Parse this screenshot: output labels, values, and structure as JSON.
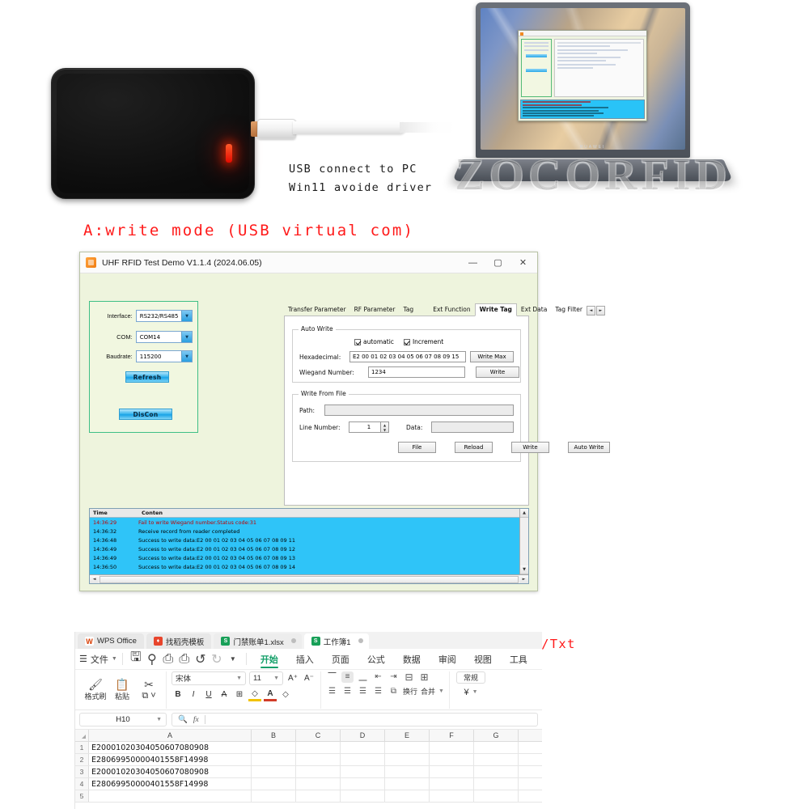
{
  "photo": {
    "device_name": "uhf-rfid-reader",
    "note_line1": "USB connect to PC",
    "note_line2": "Win11 avoide driver",
    "laptop_brand": "HUAWEI",
    "watermark": "ZOCORFID"
  },
  "captions": {
    "a": "A:write mode (USB virtual com)",
    "b": "B:USB HID keyboard Read data only.Ext Data to Excel/DO/Txt"
  },
  "rfid_app": {
    "title": "UHF RFID Test Demo V1.1.4  (2024.06.05)",
    "window_controls": {
      "minimize": "—",
      "maximize": "▢",
      "close": "✕"
    },
    "connection": {
      "interface_label": "Interface:",
      "interface_value": "RS232/RS485",
      "com_label": "COM:",
      "com_value": "COM14",
      "baudrate_label": "Baudrate:",
      "baudrate_value": "115200",
      "refresh_button": "Refresh",
      "discon_button": "DisCon"
    },
    "tabs": [
      {
        "label": "Transfer Parameter",
        "active": false
      },
      {
        "label": "RF Parameter",
        "active": false
      },
      {
        "label": "Tag",
        "active": false
      },
      {
        "label": "Ext Function",
        "active": false
      },
      {
        "label": "Write Tag",
        "active": true
      },
      {
        "label": "Ext Data",
        "active": false
      },
      {
        "label": "Tag Filter",
        "active": false
      }
    ],
    "tab_scroll": {
      "left": "◄",
      "right": "►"
    },
    "auto_write": {
      "group_title": "Auto Write",
      "chk_automatic": "automatic",
      "chk_increment": "Increment",
      "hex_label": "Hexadecimal:",
      "hex_value": "E2 00 01 02 03 04 05 06 07 08 09 15",
      "write_max_button": "Write Max",
      "wiegand_label": "Wiegand Number:",
      "wiegand_value": "1234",
      "write_button": "Write"
    },
    "write_from_file": {
      "group_title": "Write From File",
      "path_label": "Path:",
      "path_value": "",
      "line_number_label": "Line Number:",
      "line_number_value": "1",
      "data_label": "Data:",
      "data_value": "",
      "buttons": [
        "File",
        "Reload",
        "Write",
        "Auto Write"
      ]
    },
    "log": {
      "headers": [
        "Time",
        "Conten"
      ],
      "rows": [
        {
          "time": "14:36:29",
          "content": "Fail to write Wiegand number.Status code:31",
          "error": true
        },
        {
          "time": "14:36:32",
          "content": "Receive record from reader completed",
          "error": false
        },
        {
          "time": "14:36:48",
          "content": "Success to write data:E2 00 01 02 03 04 05 06 07 08 09 11",
          "error": false
        },
        {
          "time": "14:36:49",
          "content": "Success to write data:E2 00 01 02 03 04 05 06 07 08 09 12",
          "error": false
        },
        {
          "time": "14:36:49",
          "content": "Success to write data:E2 00 01 02 03 04 05 06 07 08 09 13",
          "error": false
        },
        {
          "time": "14:36:50",
          "content": "Success to write data:E2 00 01 02 03 04 05 06 07 08 09 14",
          "error": false
        }
      ]
    }
  },
  "wps": {
    "tabs": [
      {
        "label": "WPS Office",
        "icon": "wps-icon",
        "kind": "w",
        "active": false,
        "closable": false
      },
      {
        "label": "找稻壳模板",
        "icon": "template-icon",
        "kind": "d",
        "active": false,
        "closable": false
      },
      {
        "label": "门禁账单1.xlsx",
        "icon": "sheet-icon",
        "kind": "s",
        "active": false,
        "closable": true
      },
      {
        "label": "工作簿1",
        "icon": "sheet-icon",
        "kind": "s",
        "active": true,
        "closable": true
      }
    ],
    "ribbon": {
      "file_menu": "文件",
      "quick_icons": [
        "save-icon",
        "cloud-sync-icon",
        "print-icon",
        "print-preview-icon",
        "undo-icon",
        "redo-icon",
        "more-icon"
      ],
      "tabs": [
        {
          "label": "开始",
          "active": true
        },
        {
          "label": "插入",
          "active": false
        },
        {
          "label": "页面",
          "active": false
        },
        {
          "label": "公式",
          "active": false
        },
        {
          "label": "数据",
          "active": false
        },
        {
          "label": "审阅",
          "active": false
        },
        {
          "label": "视图",
          "active": false
        },
        {
          "label": "工具",
          "active": false
        }
      ]
    },
    "toolbar": {
      "format_painter": "格式刷",
      "paste": "粘贴",
      "copy": "复制",
      "font_name": "宋体",
      "font_size": "11",
      "grow_font": "A⁺",
      "shrink_font": "A⁻",
      "bold": "B",
      "italic": "I",
      "underline": "U",
      "strikethrough": "A",
      "borders": "⊞",
      "fill_color": "◇",
      "font_color": "A",
      "clear_format": "◇",
      "wrap_text": "换行",
      "merge_cells": "合并",
      "number_format": "常规",
      "currency": "¥"
    },
    "formula_bar": {
      "name_box": "H10",
      "search_icon": "search-icon",
      "fx_icon": "fx",
      "value": ""
    },
    "sheet": {
      "columns": [
        "A",
        "B",
        "C",
        "D",
        "E",
        "F",
        "G"
      ],
      "rows": [
        {
          "num": "1",
          "cells": [
            "E20001020304050607080908",
            "",
            "",
            "",
            "",
            "",
            ""
          ]
        },
        {
          "num": "2",
          "cells": [
            "E28069950000401558F14998",
            "",
            "",
            "",
            "",
            "",
            ""
          ]
        },
        {
          "num": "3",
          "cells": [
            "E20001020304050607080908",
            "",
            "",
            "",
            "",
            "",
            ""
          ]
        },
        {
          "num": "4",
          "cells": [
            "E28069950000401558F14998",
            "",
            "",
            "",
            "",
            "",
            ""
          ]
        },
        {
          "num": "5",
          "cells": [
            "",
            "",
            "",
            "",
            "",
            "",
            ""
          ]
        }
      ]
    }
  },
  "colors": {
    "caption_red": "#ff1a1a",
    "panel_green": "#f1f7e0",
    "panel_border": "#3fbf85",
    "log_blue": "#2fc4f8",
    "log_error": "#c00000",
    "wps_accent": "#15a06a",
    "led_red": "#e50b00"
  }
}
